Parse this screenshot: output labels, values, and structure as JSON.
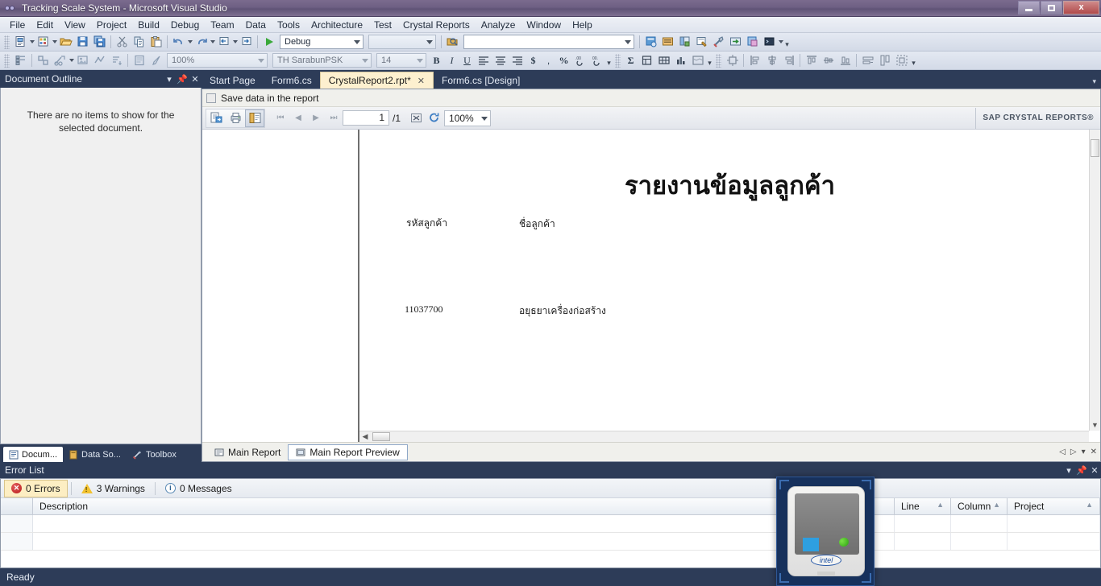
{
  "window": {
    "title": "Tracking Scale System - Microsoft Visual Studio",
    "minimize_label": "Minimize",
    "restore_label": "Restore",
    "close_label": "Close"
  },
  "menubar": {
    "items": [
      {
        "label": "File"
      },
      {
        "label": "Edit"
      },
      {
        "label": "View"
      },
      {
        "label": "Project"
      },
      {
        "label": "Build"
      },
      {
        "label": "Debug"
      },
      {
        "label": "Team"
      },
      {
        "label": "Data"
      },
      {
        "label": "Tools"
      },
      {
        "label": "Architecture"
      },
      {
        "label": "Test"
      },
      {
        "label": "Crystal Reports"
      },
      {
        "label": "Analyze"
      },
      {
        "label": "Window"
      },
      {
        "label": "Help"
      }
    ]
  },
  "standard_toolbar": {
    "configuration": "Debug",
    "configuration_placeholder": "Debug",
    "find_value": "",
    "find_placeholder": "",
    "start_label": "Start",
    "buttons": [
      {
        "name": "new-project-icon"
      },
      {
        "name": "add-new-item-icon"
      },
      {
        "name": "open-file-icon"
      },
      {
        "name": "save-icon"
      },
      {
        "name": "save-all-icon"
      },
      {
        "name": "cut-icon"
      },
      {
        "name": "copy-icon"
      },
      {
        "name": "paste-icon"
      },
      {
        "name": "undo-icon"
      },
      {
        "name": "redo-icon"
      },
      {
        "name": "navigate-backward-icon"
      },
      {
        "name": "navigate-forward-icon"
      },
      {
        "name": "start-debugging-icon"
      }
    ]
  },
  "format_toolbar": {
    "zoom": "100%",
    "font_name": "TH SarabunPSK",
    "font_size": "14",
    "bold_label": "B",
    "italic_label": "I",
    "underline_label": "U",
    "currency_label": "$",
    "comma_label": ",",
    "percent_label": "%",
    "sigma_label": "Σ"
  },
  "left_dock": {
    "panel_title": "Document Outline",
    "empty_message": "There are no items to show for the selected document.",
    "dropdown_label": "Window position",
    "pin_label": "Auto Hide",
    "close_label": "Close",
    "tabs": [
      {
        "label": "Docum...",
        "icon": "document-outline-icon",
        "active": true
      },
      {
        "label": "Data So...",
        "icon": "data-sources-icon",
        "active": false
      },
      {
        "label": "Toolbox",
        "icon": "toolbox-icon",
        "active": false
      }
    ]
  },
  "file_tabs": [
    {
      "label": "Start Page",
      "active": false,
      "dirty": false
    },
    {
      "label": "Form6.cs",
      "active": false,
      "dirty": false
    },
    {
      "label": "CrystalReport2.rpt*",
      "active": true,
      "dirty": true
    },
    {
      "label": "Form6.cs [Design]",
      "active": false,
      "dirty": false
    }
  ],
  "report_designer": {
    "save_data_label": "Save data in the report",
    "save_data_checked": false,
    "toolbar": {
      "export_label": "Export Report",
      "print_label": "Print Report",
      "toggle_tree_label": "Toggle Group Tree",
      "first_page_label": "Go to first page",
      "prev_page_label": "Go to previous page",
      "next_page_label": "Go to next page",
      "last_page_label": "Go to last page",
      "current_page": "1",
      "page_of": "/1",
      "stop_label": "Stop loading",
      "refresh_label": "Refresh",
      "zoom": "100%",
      "brand": "SAP CRYSTAL REPORTS®"
    },
    "page": {
      "title": "รายงานข้อมูลลูกค้า",
      "column_headers": [
        "รหัสลูกค้า",
        "ชื่อลูกค้า"
      ],
      "rows": [
        {
          "code": "11037700",
          "name": "อยุธยาเครื่องก่อสร้าง"
        }
      ]
    },
    "bottom_tabs": [
      {
        "label": "Main Report",
        "active": false
      },
      {
        "label": "Main Report Preview",
        "active": true
      }
    ]
  },
  "error_list": {
    "title": "Error List",
    "filters": [
      {
        "label": "0 Errors",
        "icon": "error-icon",
        "active": true
      },
      {
        "label": "3 Warnings",
        "icon": "warning-icon",
        "active": false
      },
      {
        "label": "0 Messages",
        "icon": "info-icon",
        "active": false
      }
    ],
    "columns": [
      "Description",
      "Line",
      "Column",
      "Project"
    ],
    "rows": []
  },
  "statusbar": {
    "text": "Ready"
  },
  "gadget": {
    "name": "intel-cpu-gadget",
    "logo_text": "intel"
  },
  "colors": {
    "chrome": "#2d3c58",
    "titlebar": "#6e5f83",
    "active_tab": "#fdf0cf",
    "accent": "#fdeec3",
    "error_red": "#b81d1d",
    "warning_yellow": "#f2c230"
  }
}
